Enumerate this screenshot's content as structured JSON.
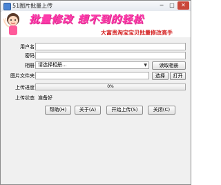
{
  "window": {
    "title": "51图片批量上传",
    "min": "─",
    "max": "□",
    "close": "✕"
  },
  "banner": {
    "headline": "批量修改  想不到的轻松",
    "subline": "大富贵淘宝宝贝批量修改高手"
  },
  "form": {
    "username": {
      "label": "用户名",
      "value": ""
    },
    "password": {
      "label": "密码",
      "value": ""
    },
    "album": {
      "label": "相册",
      "value": "请选择相册...",
      "read_button": "读取相册"
    },
    "folder": {
      "label": "图片文件夹",
      "value": "",
      "choose_button": "选择",
      "open_button": "打开"
    },
    "progress": {
      "label": "上传进度",
      "value_text": "0%",
      "value": 0
    },
    "status": {
      "label": "上传状态",
      "value": "准备好"
    }
  },
  "buttons": {
    "help": "帮助(H)",
    "about": "关于(A)",
    "start": "开始上传(S)",
    "close": "关闭(C)"
  },
  "colors": {
    "banner_pink": "#ff3cac",
    "banner_red": "#d42020",
    "progress": "#5cc15c"
  }
}
